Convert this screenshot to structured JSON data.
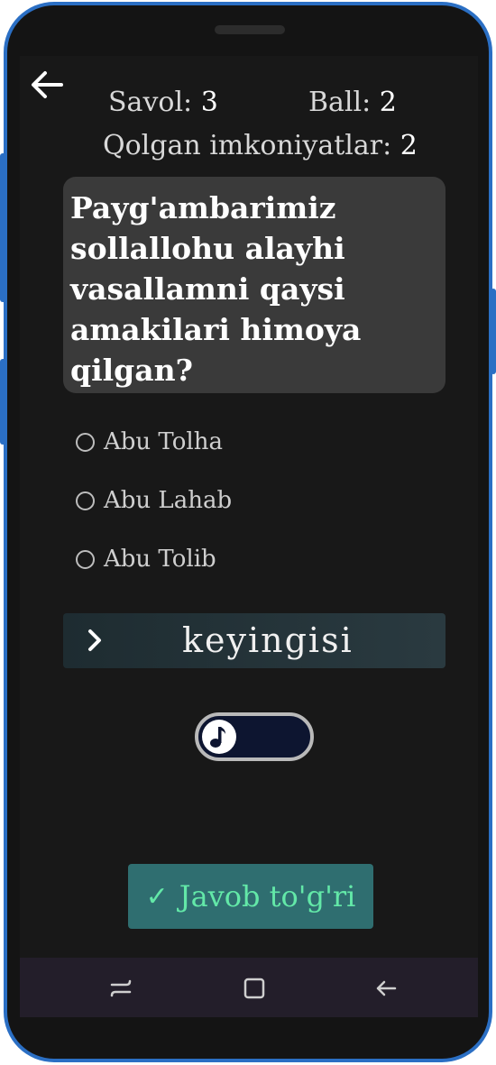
{
  "header": {
    "question_label": "Savol:",
    "question_number": "3",
    "score_label": "Ball:",
    "score_value": "2",
    "attempts_label": "Qolgan imkoniyatlar:",
    "attempts_value": "2"
  },
  "question": {
    "text": "Payg'ambarimiz sollallohu alayhi vasallamni qaysi amakilari himoya qilgan?"
  },
  "options": [
    {
      "label": "Abu Tolha",
      "selected": false
    },
    {
      "label": "Abu Lahab",
      "selected": false
    },
    {
      "label": "Abu Tolib",
      "selected": false
    }
  ],
  "next_button": {
    "label": "keyingisi"
  },
  "music_toggle": {
    "icon": "music-note-icon",
    "enabled": false
  },
  "result": {
    "check": "✓",
    "label": "Javob to'g'ri"
  },
  "colors": {
    "background": "#181818",
    "card": "#3a3a3a",
    "answer_badge": "#2f6e70",
    "answer_text": "#63e8a8",
    "frame_accent": "#2b6fc4"
  }
}
